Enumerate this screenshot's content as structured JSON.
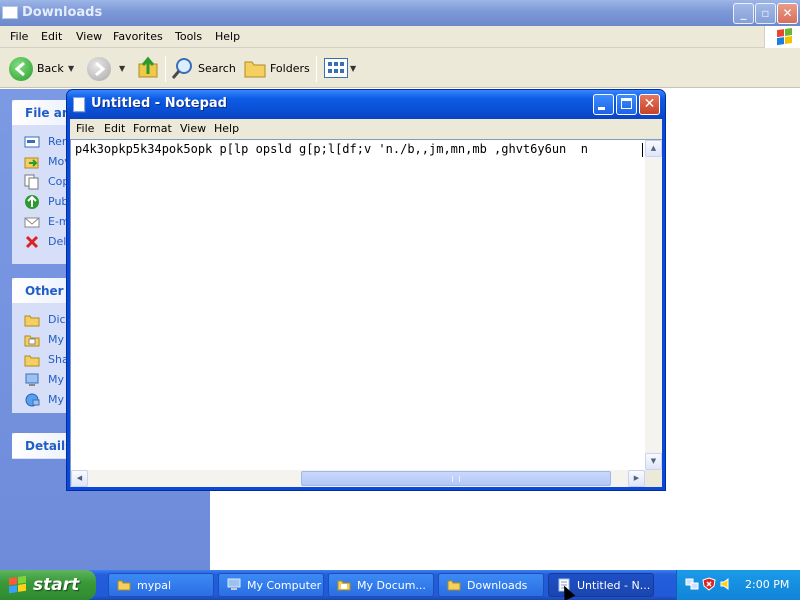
{
  "explorer": {
    "title": "Downloads",
    "menu": [
      "File",
      "Edit",
      "View",
      "Favorites",
      "Tools",
      "Help"
    ],
    "toolbar": {
      "back": "Back",
      "search": "Search",
      "folders": "Folders"
    },
    "left_pane": {
      "panel1": {
        "title": "File and Folder Tasks",
        "title_visible": "File and",
        "items": [
          "Ren",
          "Mov",
          "Cop",
          "Pub",
          "E-m",
          "Dele"
        ]
      },
      "panel2": {
        "title_visible": "Other P",
        "items": [
          "Dick",
          "My",
          "Sha",
          "My",
          "My"
        ]
      },
      "panel3": {
        "title_visible": "Details"
      }
    }
  },
  "notepad": {
    "title": "Untitled - Notepad",
    "menu": [
      "File",
      "Edit",
      "Format",
      "View",
      "Help"
    ],
    "content": "p4k3opkp5k34pok5opk p[lp opsld g[p;l[df;v 'n./b,,jm,mn,mb ,ghvt6y6un  n"
  },
  "taskbar": {
    "start": "start",
    "tasks": [
      "mypal",
      "My Computer",
      "My Docum...",
      "Downloads",
      "Untitled - N..."
    ],
    "active_task_index": 4,
    "clock": "2:00 PM"
  },
  "colors": {
    "xp_blue": "#0a4fd4",
    "taskbar_blue": "#245edb",
    "start_green": "#3a9a3a",
    "tray_blue": "#1184d8",
    "menu_gray": "#ece9d8",
    "panel_blue": "#d6dff7"
  },
  "icons": {
    "back": "back-arrow-icon",
    "forward": "forward-arrow-icon",
    "up": "up-folder-icon",
    "search": "magnifier-icon",
    "folders": "folder-icon",
    "views": "views-grid-icon"
  }
}
